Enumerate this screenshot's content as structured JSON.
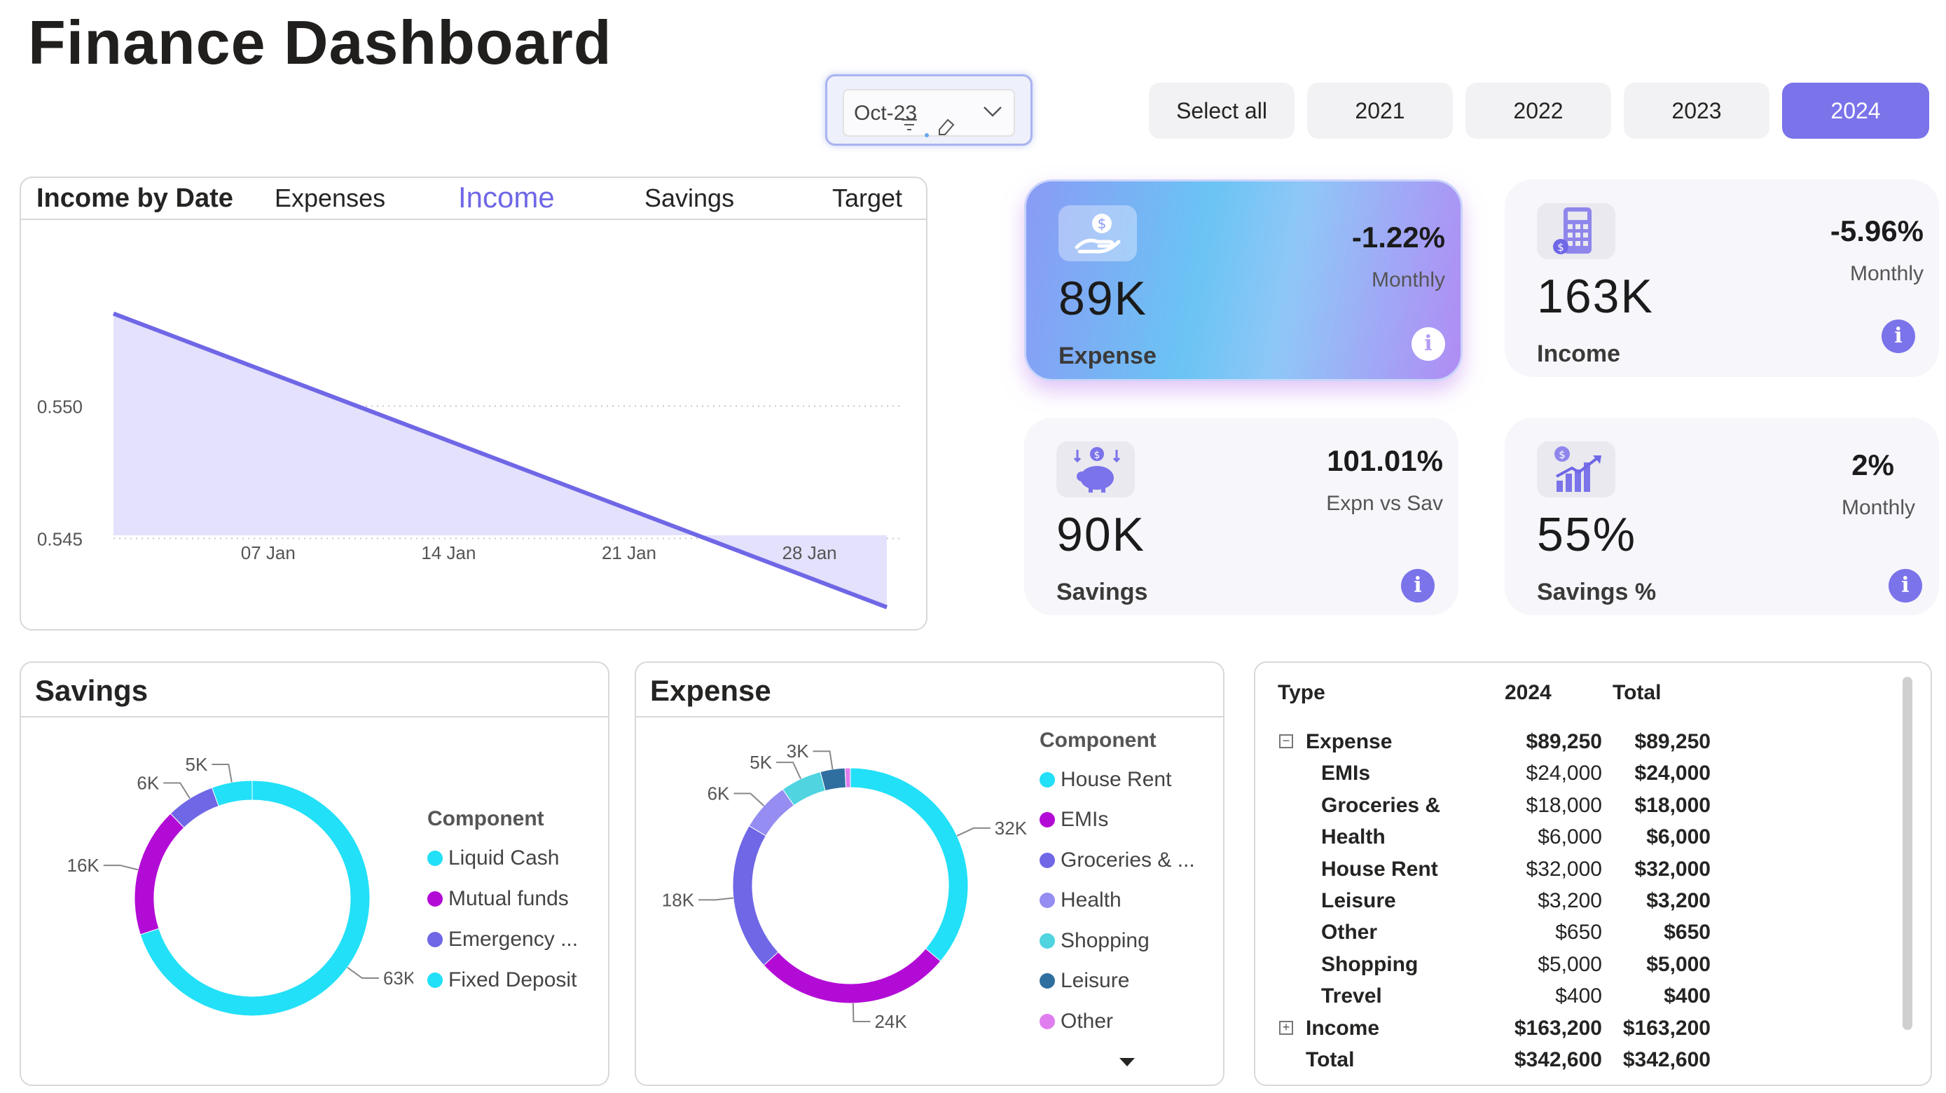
{
  "title": "Finance Dashboard",
  "slicer": {
    "value": "Oct-23"
  },
  "years": [
    {
      "label": "Select all",
      "active": false
    },
    {
      "label": "2021",
      "active": false
    },
    {
      "label": "2022",
      "active": false
    },
    {
      "label": "2023",
      "active": false
    },
    {
      "label": "2024",
      "active": true
    }
  ],
  "income_chart": {
    "title": "Income by Date",
    "tabs": [
      "Expenses",
      "Income",
      "Savings",
      "Target"
    ],
    "active_tab": "Income"
  },
  "kpis": {
    "expense": {
      "value": "89K",
      "label": "Expense",
      "pct": "-1.22%",
      "sub": "Monthly"
    },
    "income": {
      "value": "163K",
      "label": "Income",
      "pct": "-5.96%",
      "sub": "Monthly"
    },
    "savings": {
      "value": "90K",
      "label": "Savings",
      "pct": "101.01%",
      "sub": "Expn vs Sav"
    },
    "savings_pct": {
      "value": "55%",
      "label": "Savings %",
      "pct": "2%",
      "sub": "Monthly"
    }
  },
  "savings_panel": {
    "title": "Savings",
    "legend_title": "Component",
    "legend": [
      "Liquid Cash",
      "Mutual funds",
      "Emergency ...",
      "Fixed Deposit"
    ],
    "data_labels": [
      "63K",
      "16K",
      "6K",
      "5K"
    ]
  },
  "expense_panel": {
    "title": "Expense",
    "legend_title": "Component",
    "legend": [
      "House Rent",
      "EMIs",
      "Groceries & ...",
      "Health",
      "Shopping",
      "Leisure",
      "Other"
    ],
    "data_labels": [
      "32K",
      "24K",
      "18K",
      "6K",
      "5K",
      "3K"
    ]
  },
  "table": {
    "headers": {
      "type": "Type",
      "y2024": "2024",
      "total": "Total"
    },
    "rows": [
      {
        "type": "Expense",
        "y2024": "$89,250",
        "total": "$89,250"
      },
      {
        "type": "EMIs",
        "y2024": "$24,000",
        "total": "$24,000"
      },
      {
        "type": "Groceries &",
        "y2024": "$18,000",
        "total": "$18,000"
      },
      {
        "type": "Health",
        "y2024": "$6,000",
        "total": "$6,000"
      },
      {
        "type": "House Rent",
        "y2024": "$32,000",
        "total": "$32,000"
      },
      {
        "type": "Leisure",
        "y2024": "$3,200",
        "total": "$3,200"
      },
      {
        "type": "Other",
        "y2024": "$650",
        "total": "$650"
      },
      {
        "type": "Shopping",
        "y2024": "$5,000",
        "total": "$5,000"
      },
      {
        "type": "Trevel",
        "y2024": "$400",
        "total": "$400"
      },
      {
        "type": "Income",
        "y2024": "$163,200",
        "total": "$163,200"
      },
      {
        "type": "Total",
        "y2024": "$342,600",
        "total": "$342,600"
      }
    ]
  },
  "chart_data": [
    {
      "type": "area",
      "title": "Income by Date",
      "x": [
        "2024-01-01",
        "2024-01-31"
      ],
      "x_ticks": [
        "07 Jan",
        "14 Jan",
        "21 Jan",
        "28 Jan"
      ],
      "y": [
        0.5535,
        0.5424
      ],
      "y_ticks": [
        "0.550",
        "0.545"
      ],
      "ylim": [
        0.5421,
        0.5564
      ],
      "grid": true,
      "color": "#6f67e6"
    },
    {
      "type": "pie",
      "title": "Savings",
      "categories": [
        "Liquid Cash",
        "Mutual funds",
        "Emergency ...",
        "Fixed Deposit"
      ],
      "values": [
        63,
        16,
        6,
        5
      ],
      "colors": [
        "#22e0f7",
        "#b30bd6",
        "#6f67e6",
        "#22e0f7"
      ]
    },
    {
      "type": "pie",
      "title": "Expense",
      "categories": [
        "House Rent",
        "EMIs",
        "Groceries & ...",
        "Health",
        "Shopping",
        "Leisure",
        "Other"
      ],
      "values": [
        32,
        24,
        18,
        6,
        5,
        3,
        0.65
      ],
      "colors": [
        "#22e0f7",
        "#b30bd6",
        "#6f67e6",
        "#958df2",
        "#4fd4e0",
        "#2f6f9f",
        "#e07ef0"
      ]
    }
  ]
}
